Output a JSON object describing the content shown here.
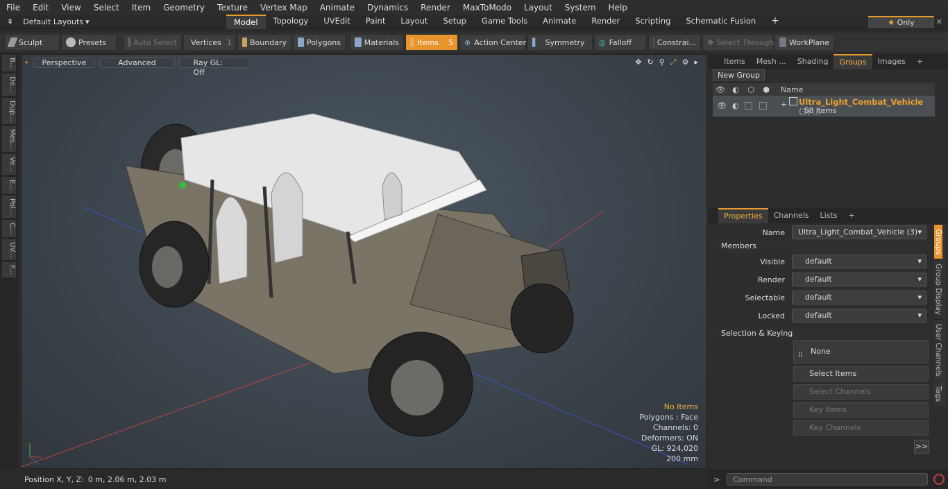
{
  "menubar": [
    "File",
    "Edit",
    "View",
    "Select",
    "Item",
    "Geometry",
    "Texture",
    "Vertex Map",
    "Animate",
    "Dynamics",
    "Render",
    "MaxToModo",
    "Layout",
    "System",
    "Help"
  ],
  "tabbar": {
    "layout": "Default Layouts",
    "tabs": [
      "Model",
      "Topology",
      "UVEdit",
      "Paint",
      "Layout",
      "Setup",
      "Game Tools",
      "Animate",
      "Render",
      "Scripting",
      "Schematic Fusion"
    ],
    "active": "Model",
    "only": "Only"
  },
  "toolbar": {
    "sculpt": "Sculpt",
    "presets": "Presets",
    "auto_select": "Auto Select",
    "vertices": "Vertices",
    "vertices_count": "1",
    "boundary": "Boundary",
    "polygons": "Polygons",
    "materials": "Materials",
    "items": "Items",
    "items_count": "5",
    "action_center": "Action Center",
    "symmetry": "Symmetry",
    "falloff": "Falloff",
    "constraints": "Constrai...",
    "select_through": "Select Through",
    "workplane": "WorkPlane"
  },
  "lefttabs": [
    "B...",
    "De...",
    "Dup...",
    "Mes...",
    "Ve...",
    "E...",
    "Pol...",
    "C...",
    "UV...",
    "F..."
  ],
  "viewport": {
    "perspective": "Perspective",
    "advanced": "Advanced",
    "raygl": "Ray GL: Off",
    "info": {
      "items": "No Items",
      "polygons": "Polygons : Face",
      "channels": "Channels: 0",
      "deformers": "Deformers: ON",
      "gl": "GL: 924,020",
      "scale": "200 mm"
    }
  },
  "status": {
    "position_label": "Position X, Y, Z:",
    "position_value": "0 m, 2.06 m, 2.03 m"
  },
  "rightpanel": {
    "tabs": [
      "Items",
      "Mesh ...",
      "Shading",
      "Groups",
      "Images"
    ],
    "active_tab": "Groups",
    "new_group": "New Group",
    "col_name": "Name",
    "group_name": "Ultra_Light_Combat_Vehicle",
    "group_count": "(3) ...",
    "group_items": "58 Items",
    "prop_tabs": [
      "Properties",
      "Channels",
      "Lists"
    ],
    "name_label": "Name",
    "name_value": "Ultra_Light_Combat_Vehicle (3)",
    "members": "Members",
    "rows": [
      {
        "label": "Visible",
        "value": "default"
      },
      {
        "label": "Render",
        "value": "default"
      },
      {
        "label": "Selectable",
        "value": "default"
      },
      {
        "label": "Locked",
        "value": "default"
      }
    ],
    "selkey": "Selection & Keying",
    "none": "None",
    "select_items": "Select Items",
    "select_channels": "Select Channels",
    "key_items": "Key Items",
    "key_channels": "Key Channels",
    "more": ">>",
    "vtabs": [
      "Groups",
      "Group Display",
      "User Channels",
      "Tags"
    ],
    "command": "Command"
  }
}
